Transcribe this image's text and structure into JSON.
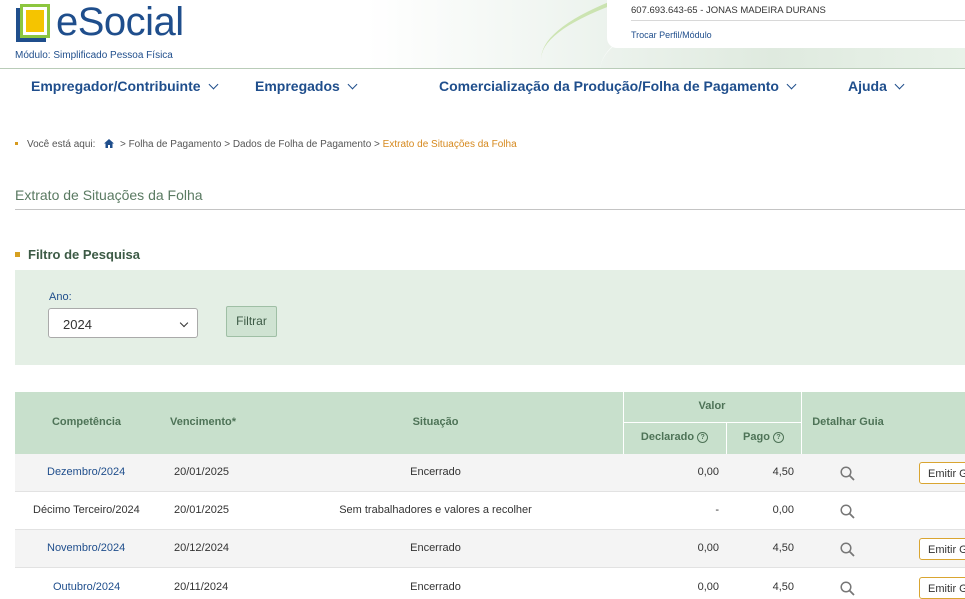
{
  "header": {
    "logo_text": "eSocial",
    "module": "Módulo: Simplificado Pessoa Física",
    "user": "607.693.643-65 - JONAS MADEIRA DURANS",
    "switch_profile": "Trocar Perfil/Módulo"
  },
  "menu": [
    {
      "label": "Empregador/Contribuinte"
    },
    {
      "label": "Empregados"
    },
    {
      "label": "Comercialização da Produção/Folha de Pagamento"
    },
    {
      "label": "Ajuda"
    }
  ],
  "breadcrumb": {
    "prefix": "Você está aqui:",
    "items": [
      "Folha de Pagamento",
      "Dados de Folha de Pagamento"
    ],
    "current": "Extrato de Situações da Folha"
  },
  "page_title": "Extrato de Situações da Folha",
  "filter": {
    "title": "Filtro de Pesquisa",
    "year_label": "Ano:",
    "year_value": "2024",
    "filter_button": "Filtrar"
  },
  "table": {
    "headers": {
      "competencia": "Competência",
      "vencimento": "Vencimento*",
      "situacao": "Situação",
      "valor": "Valor",
      "declarado": "Declarado",
      "pago": "Pago",
      "detalhar": "Detalhar Guia"
    },
    "rows": [
      {
        "competencia": "Dezembro/2024",
        "vencimento": "20/01/2025",
        "situacao": "Encerrado",
        "declarado": "0,00",
        "pago": "4,50",
        "action": "Emitir G"
      },
      {
        "competencia": "Décimo Terceiro/2024",
        "vencimento": "20/01/2025",
        "situacao": "Sem trabalhadores e valores a recolher",
        "declarado": "-",
        "pago": "0,00",
        "action": ""
      },
      {
        "competencia": "Novembro/2024",
        "vencimento": "20/12/2024",
        "situacao": "Encerrado",
        "declarado": "0,00",
        "pago": "4,50",
        "action": "Emitir G"
      },
      {
        "competencia": "Outubro/2024",
        "vencimento": "20/11/2024",
        "situacao": "Encerrado",
        "declarado": "0,00",
        "pago": "4,50",
        "action": "Emitir G"
      }
    ]
  },
  "colors": {
    "brand_blue": "#1f4e8c",
    "table_header": "#c8e0cc",
    "filter_bg": "#e4efe5",
    "accent_orange": "#d6891e"
  }
}
